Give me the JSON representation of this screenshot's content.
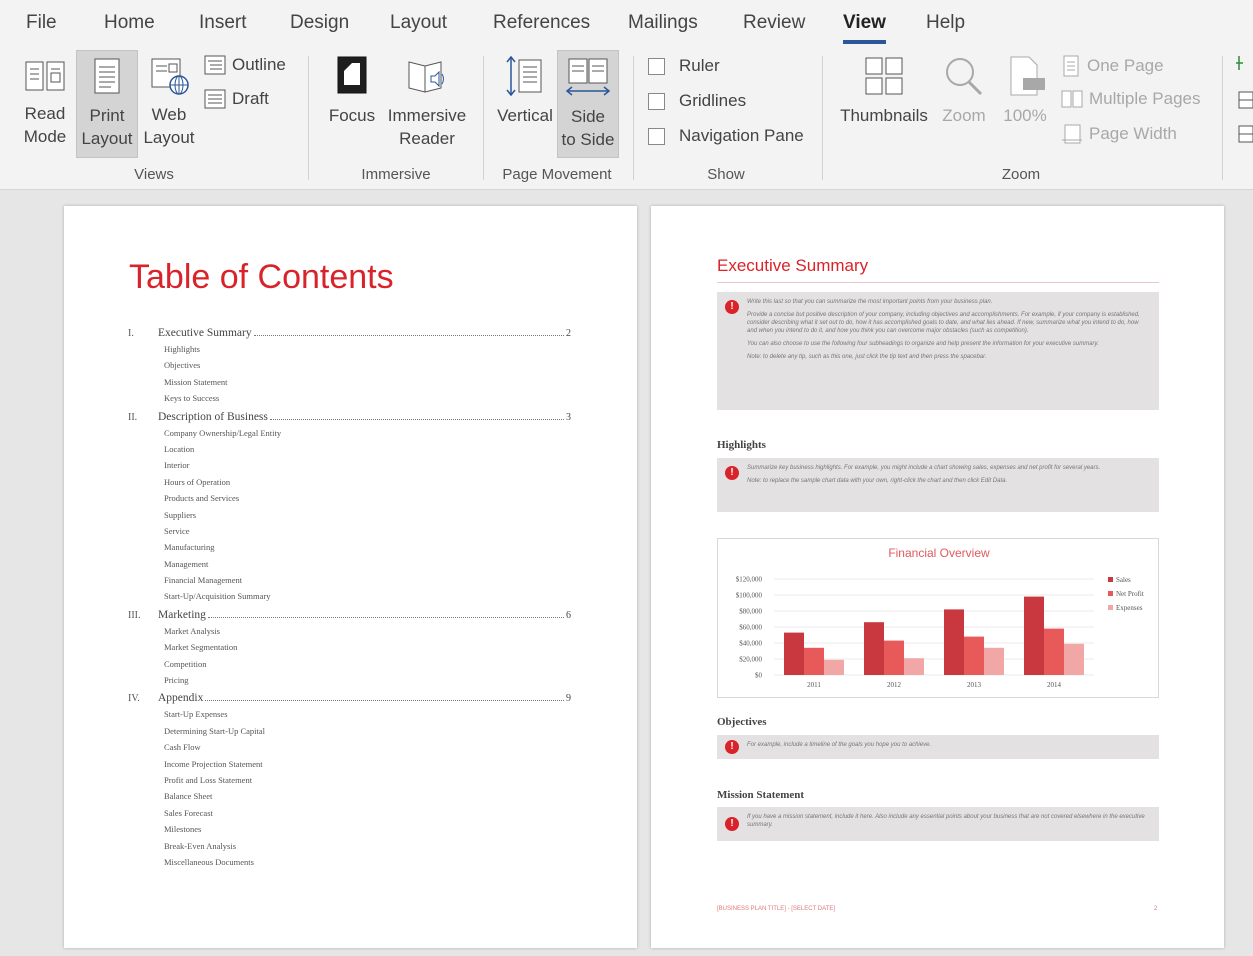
{
  "tabs": [
    "File",
    "Home",
    "Insert",
    "Design",
    "Layout",
    "References",
    "Mailings",
    "Review",
    "View",
    "Help"
  ],
  "active_tab": "View",
  "ribbon": {
    "views": {
      "label": "Views",
      "read_mode": [
        "Read",
        "Mode"
      ],
      "print_layout": [
        "Print",
        "Layout"
      ],
      "web_layout": [
        "Web",
        "Layout"
      ],
      "outline": "Outline",
      "draft": "Draft"
    },
    "immersive": {
      "label": "Immersive",
      "focus": "Focus",
      "immersive_reader": [
        "Immersive",
        "Reader"
      ]
    },
    "page_movement": {
      "label": "Page Movement",
      "vertical": "Vertical",
      "side_to_side": [
        "Side",
        "to Side"
      ]
    },
    "show": {
      "label": "Show",
      "ruler": "Ruler",
      "gridlines": "Gridlines",
      "navigation_pane": "Navigation Pane"
    },
    "zoom": {
      "label": "Zoom",
      "thumbnails": "Thumbnails",
      "zoom": "Zoom",
      "hundred": "100%",
      "one_page": "One Page",
      "multiple_pages": "Multiple Pages",
      "page_width": "Page Width"
    }
  },
  "page1": {
    "title": "Table of Contents",
    "sections": [
      {
        "num": "I.",
        "title": "Executive Summary",
        "page": "2",
        "items": [
          "Highlights",
          "Objectives",
          "Mission Statement",
          "Keys to Success"
        ]
      },
      {
        "num": "II.",
        "title": "Description of Business",
        "page": "3",
        "items": [
          "Company Ownership/Legal Entity",
          "Location",
          "Interior",
          "Hours of Operation",
          "Products and Services",
          "Suppliers",
          "Service",
          "Manufacturing",
          "Management",
          "Financial Management",
          "Start-Up/Acquisition Summary"
        ]
      },
      {
        "num": "III.",
        "title": "Marketing",
        "page": "6",
        "items": [
          "Market Analysis",
          "Market Segmentation",
          "Competition",
          "Pricing"
        ]
      },
      {
        "num": "IV.",
        "title": "Appendix",
        "page": "9",
        "items": [
          "Start-Up Expenses",
          "Determining Start-Up Capital",
          "Cash Flow",
          "Income Projection Statement",
          "Profit and Loss Statement",
          "Balance Sheet",
          "Sales Forecast",
          "Milestones",
          "Break-Even Analysis",
          "Miscellaneous Documents"
        ]
      }
    ]
  },
  "page2": {
    "title": "Executive Summary",
    "tip1": [
      "Write this last so that you can summarize the most important points from your business plan.",
      "Provide a concise but positive description of your company, including objectives and accomplishments. For example, if your company is established, consider describing what it set out to do, how it has accomplished goals to date, and what lies ahead. If new, summarize what you intend to do, how and when you intend to do it, and how you think you can overcome major obstacles (such as competition).",
      "You can also choose to use the following four subheadings to organize and help present the information for your executive summary.",
      "Note: to delete any tip, such as this one, just click the tip text and then press the spacebar."
    ],
    "highlights": "Highlights",
    "tip2": [
      "Summarize key business highlights. For example, you might include a chart showing sales, expenses and net profit for several years.",
      "Note: to replace the sample chart data with your own, right-click the chart and then click Edit Data."
    ],
    "objectives": "Objectives",
    "tip3": [
      "For example, include a timeline of the goals you hope you to achieve."
    ],
    "mission": "Mission Statement",
    "tip4": [
      "If you have a mission statement, include it here. Also include any essential points about your business that are not covered elsewhere in the executive summary."
    ],
    "footer_left": "[BUSINESS PLAN TITLE] - [SELECT DATE]",
    "footer_right": "2"
  },
  "chart_data": {
    "type": "bar",
    "title": "Financial Overview",
    "categories": [
      "2011",
      "2012",
      "2013",
      "2014"
    ],
    "series": [
      {
        "name": "Sales",
        "values": [
          53000,
          66000,
          82000,
          98000
        ],
        "color": "#c9373f"
      },
      {
        "name": "Net Profit",
        "values": [
          34000,
          43000,
          48000,
          58000
        ],
        "color": "#e85a5a"
      },
      {
        "name": "Expenses",
        "values": [
          19000,
          21000,
          34000,
          39000
        ],
        "color": "#f2a7a7"
      }
    ],
    "ylim": [
      0,
      120000
    ],
    "yticks": [
      "$0",
      "$20,000",
      "$40,000",
      "$60,000",
      "$80,000",
      "$100,000",
      "$120,000"
    ],
    "legend": "right",
    "grid": true
  },
  "colors": {
    "accent_red": "#d9232a",
    "word_blue": "#2b579a"
  }
}
